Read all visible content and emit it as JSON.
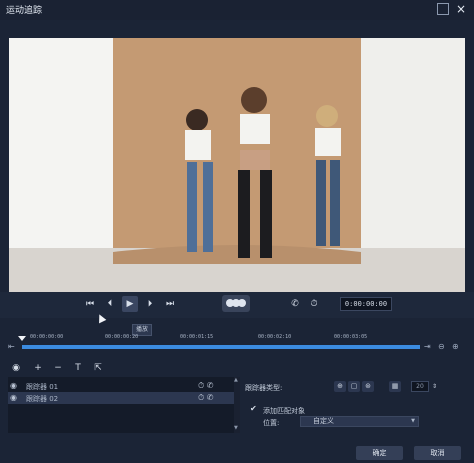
{
  "window": {
    "title": "运动追踪",
    "maximize_icon": "maximize-icon",
    "close_label": "×"
  },
  "playback": {
    "buttons": [
      {
        "name": "go-to-start",
        "glyph": "⏮"
      },
      {
        "name": "previous-frame",
        "glyph": "⏴"
      },
      {
        "name": "play",
        "glyph": "▶"
      },
      {
        "name": "next-frame",
        "glyph": "⏵"
      },
      {
        "name": "go-to-end",
        "glyph": "⏭"
      }
    ],
    "tooltip": "播放",
    "timecode": "0:00:00:00",
    "track_icons": [
      "phone-icon",
      "clock-icon"
    ]
  },
  "timeline": {
    "ticks": [
      "00:00:00:00",
      "00:00:00:20",
      "00:00:01:15",
      "00:00:02:10",
      "00:00:03:05"
    ],
    "playhead_fraction": 0.0,
    "progress_fraction": 1.0
  },
  "toolbar": {
    "icons": [
      "eye-icon",
      "add-icon",
      "remove-icon",
      "text-icon",
      "export-icon"
    ]
  },
  "trackers": {
    "items": [
      {
        "label": "跟踪器 01",
        "selected": false
      },
      {
        "label": "跟踪器 02",
        "selected": true
      }
    ]
  },
  "properties": {
    "tracker_type_label": "跟踪器类型:",
    "shape_buttons": [
      "⊕",
      "▢",
      "⊛"
    ],
    "number_value": "20",
    "add_match_label": "添加匹配对象",
    "position_label": "位置:",
    "position_value": "自定义"
  },
  "footer": {
    "ok_label": "确定",
    "cancel_label": "取消"
  },
  "colors": {
    "background": "#1b2436",
    "accent": "#3b8be0",
    "panel": "#141b29"
  }
}
